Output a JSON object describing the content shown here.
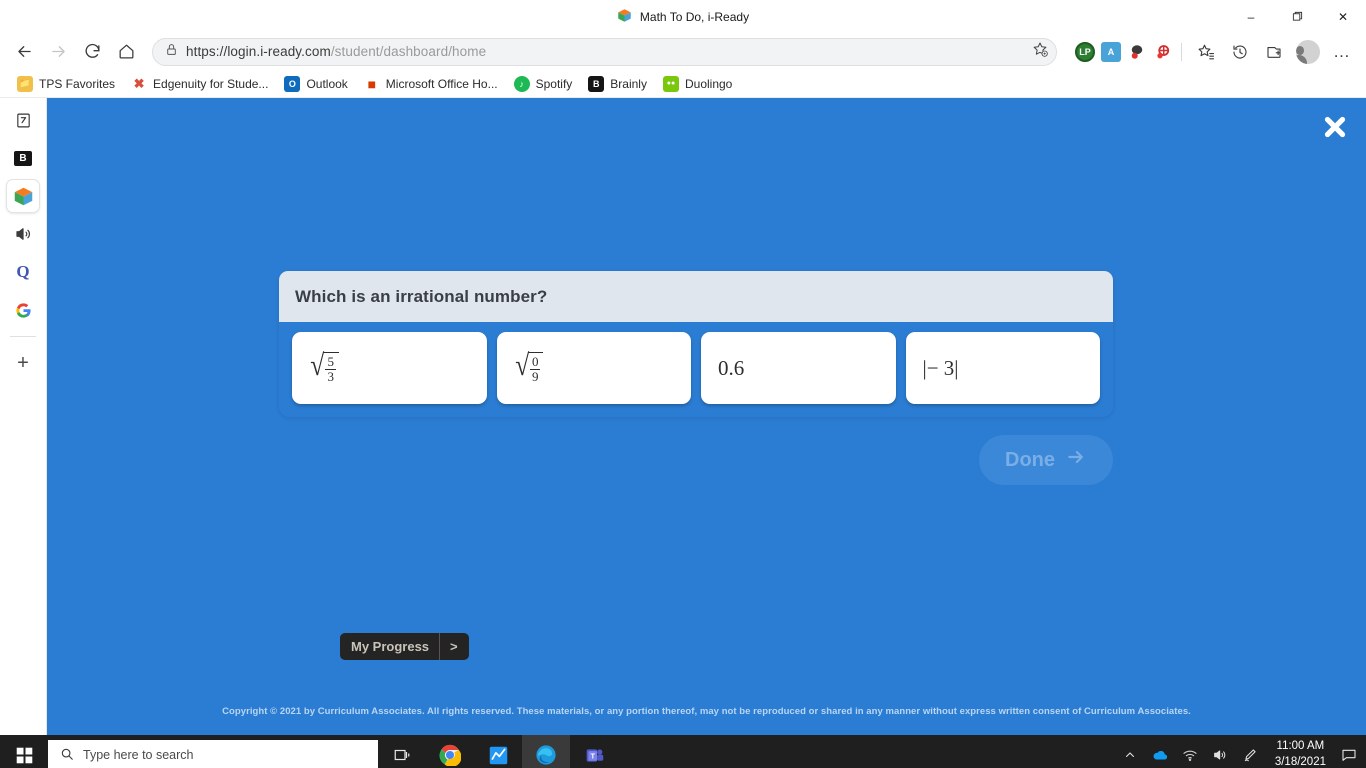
{
  "window": {
    "title": "Math To Do, i-Ready",
    "minimize_label": "–",
    "maximize_label": "❐",
    "close_label": "✕"
  },
  "toolbar": {
    "back_label": "←",
    "forward_label": "→",
    "reload_label": "⟳",
    "home_label": "⌂",
    "url_host": "https://login.i-ready.com",
    "url_path": "/student/dashboard/home",
    "url_full": "https://login.i-ready.com/student/dashboard/home",
    "lock_icon": "🔒",
    "favorite_add_label": "☆",
    "extensions": [
      {
        "name": "lastpass-extension",
        "label": "LP",
        "color": "#2e7d32"
      },
      {
        "name": "grammarly-extension",
        "label": "A",
        "color": "#4aa3d8"
      },
      {
        "name": "kami-extension",
        "label": "K",
        "color": "#c62828"
      },
      {
        "name": "adblock-extension",
        "label": "O",
        "color": "#d32f2f"
      }
    ],
    "favorites_label": "☆",
    "history_label": "↺",
    "collections_label": "⊞",
    "profile_label": "profile",
    "settings_label": "…"
  },
  "bookmarks": [
    {
      "label": "TPS Favorites",
      "icon": "folder-icon",
      "color": "#e8b64c",
      "text": "📁"
    },
    {
      "label": "Edgenuity for Stude...",
      "icon": "edgenuity-icon",
      "color": "#ffffff",
      "text": "✖"
    },
    {
      "label": "Outlook",
      "icon": "outlook-icon",
      "color": "#0f6cbd",
      "text": "O"
    },
    {
      "label": "Microsoft Office Ho...",
      "icon": "office-icon",
      "color": "#d83b01",
      "text": "█"
    },
    {
      "label": "Spotify",
      "icon": "spotify-icon",
      "color": "#1db954",
      "text": "♫"
    },
    {
      "label": "Brainly",
      "icon": "brainly-icon",
      "color": "#111111",
      "text": "B"
    },
    {
      "label": "Duolingo",
      "icon": "duolingo-icon",
      "color": "#7ac70c",
      "text": "●●"
    }
  ],
  "sidebar": {
    "items": [
      {
        "name": "sidebar-tab-document",
        "glyph": "⧉",
        "color": "#333333",
        "active": false
      },
      {
        "name": "sidebar-tab-brainly",
        "glyph": "B",
        "color": "#111111",
        "active": false
      },
      {
        "name": "sidebar-tab-iready",
        "glyph": "cube",
        "color": "#ff8c00",
        "active": true
      },
      {
        "name": "sidebar-tab-speaker",
        "glyph": "🔊",
        "color": "#444444",
        "active": false
      },
      {
        "name": "sidebar-tab-quizlet",
        "glyph": "Q",
        "color": "#4257b2",
        "active": false
      },
      {
        "name": "sidebar-tab-google",
        "glyph": "G",
        "color": "#4285f4",
        "active": false
      }
    ],
    "add_label": "+"
  },
  "page": {
    "close_label": "✖",
    "background_color": "#2b7cd3",
    "question": "Which is an irrational number?",
    "choices": [
      {
        "id": "choice-a",
        "type": "sqrt-fraction",
        "numerator": "5",
        "denominator": "3",
        "text": "√(5/3)"
      },
      {
        "id": "choice-b",
        "type": "sqrt-fraction",
        "numerator": "0",
        "denominator": "9",
        "text": "√(0/9)"
      },
      {
        "id": "choice-c",
        "type": "plain",
        "text": "0.6"
      },
      {
        "id": "choice-d",
        "type": "plain",
        "text": "|− 3|"
      }
    ],
    "done_label": "Done",
    "done_arrow": "→",
    "done_enabled": false,
    "progress_label": "My Progress",
    "progress_chevron": ">",
    "copyright": "Copyright © 2021 by Curriculum Associates. All rights reserved. These materials, or any portion thereof, may not be reproduced or shared in any manner without express written consent of Curriculum Associates."
  },
  "taskbar": {
    "start_label": "⊞",
    "search_placeholder": "Type here to search",
    "search_icon": "🔍",
    "apps": [
      {
        "name": "task-view",
        "label": "⫼",
        "active": false
      },
      {
        "name": "chrome-app",
        "label": "chrome",
        "active": false
      },
      {
        "name": "blue-app",
        "label": "∿",
        "active": false
      },
      {
        "name": "edge-app",
        "label": "edge",
        "active": true
      },
      {
        "name": "teams-app",
        "label": "T",
        "active": false
      }
    ],
    "tray": [
      {
        "name": "show-hidden-icons",
        "glyph": "⌃"
      },
      {
        "name": "onedrive-icon",
        "glyph": "☁"
      },
      {
        "name": "wifi-icon",
        "glyph": "◠"
      },
      {
        "name": "volume-icon",
        "glyph": "🔊"
      },
      {
        "name": "pen-icon",
        "glyph": "✎"
      }
    ],
    "time": "11:00 AM",
    "date": "3/18/2021",
    "notification_label": "▭"
  }
}
